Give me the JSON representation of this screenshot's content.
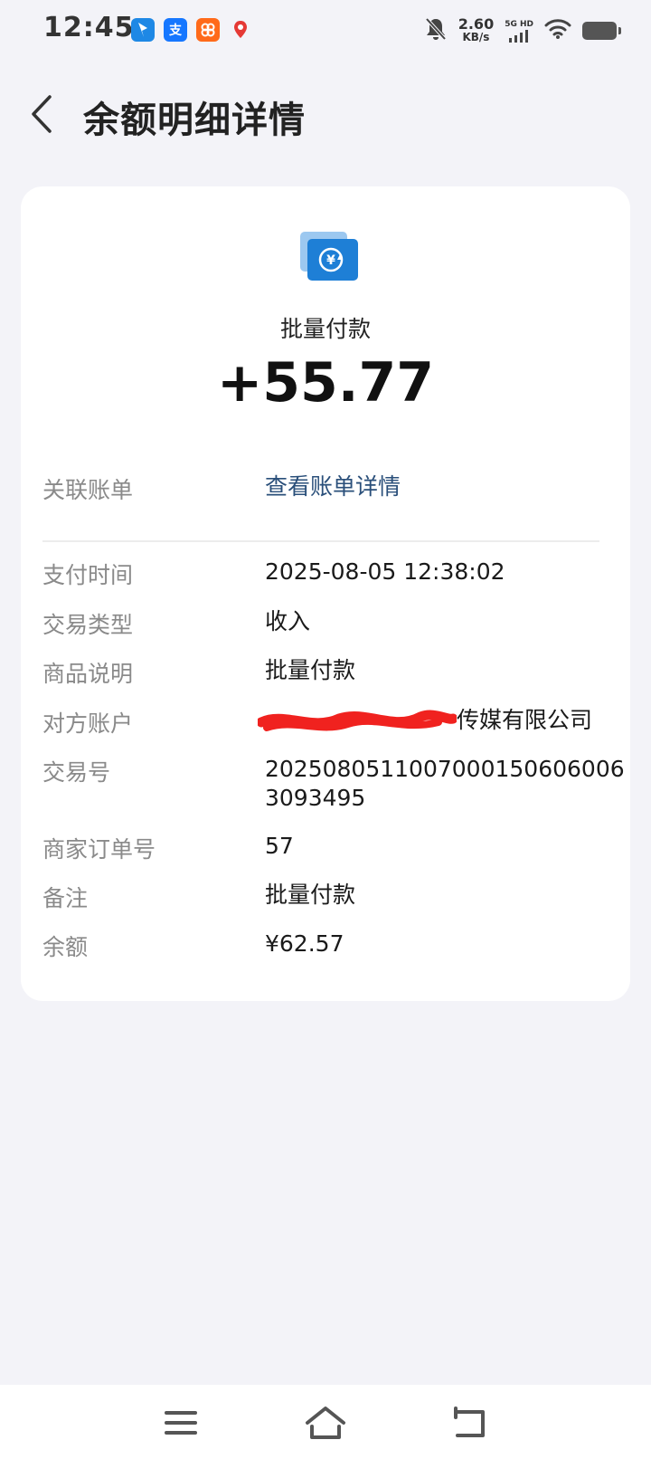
{
  "status_bar": {
    "time": "12:45",
    "net_speed_value": "2.60",
    "net_speed_unit": "KB/s",
    "signal_tag": "5G HD"
  },
  "header": {
    "title": "余额明细详情"
  },
  "summary": {
    "type": "批量付款",
    "amount": "+55.77"
  },
  "linked_bill": {
    "label": "关联账单",
    "value": "查看账单详情"
  },
  "details": {
    "pay_time_label": "支付时间",
    "pay_time": "2025-08-05 12:38:02",
    "tx_type_label": "交易类型",
    "tx_type": "收入",
    "product_label": "商品说明",
    "product": "批量付款",
    "counterparty_label": "对方账户",
    "counterparty_visible": "传媒有限公司",
    "tx_no_label": "交易号",
    "tx_no": "2025080511007000150606006 3093495",
    "merchant_order_label": "商家订单号",
    "merchant_order": "57",
    "note_label": "备注",
    "note": "批量付款",
    "balance_label": "余额",
    "balance": "¥62.57"
  },
  "colors": {
    "background": "#f3f3f8",
    "card": "#ffffff",
    "link": "#2a4f7a",
    "label": "#8a8a8a",
    "icon_blue": "#1e7fd6",
    "redaction": "#f0221f"
  }
}
